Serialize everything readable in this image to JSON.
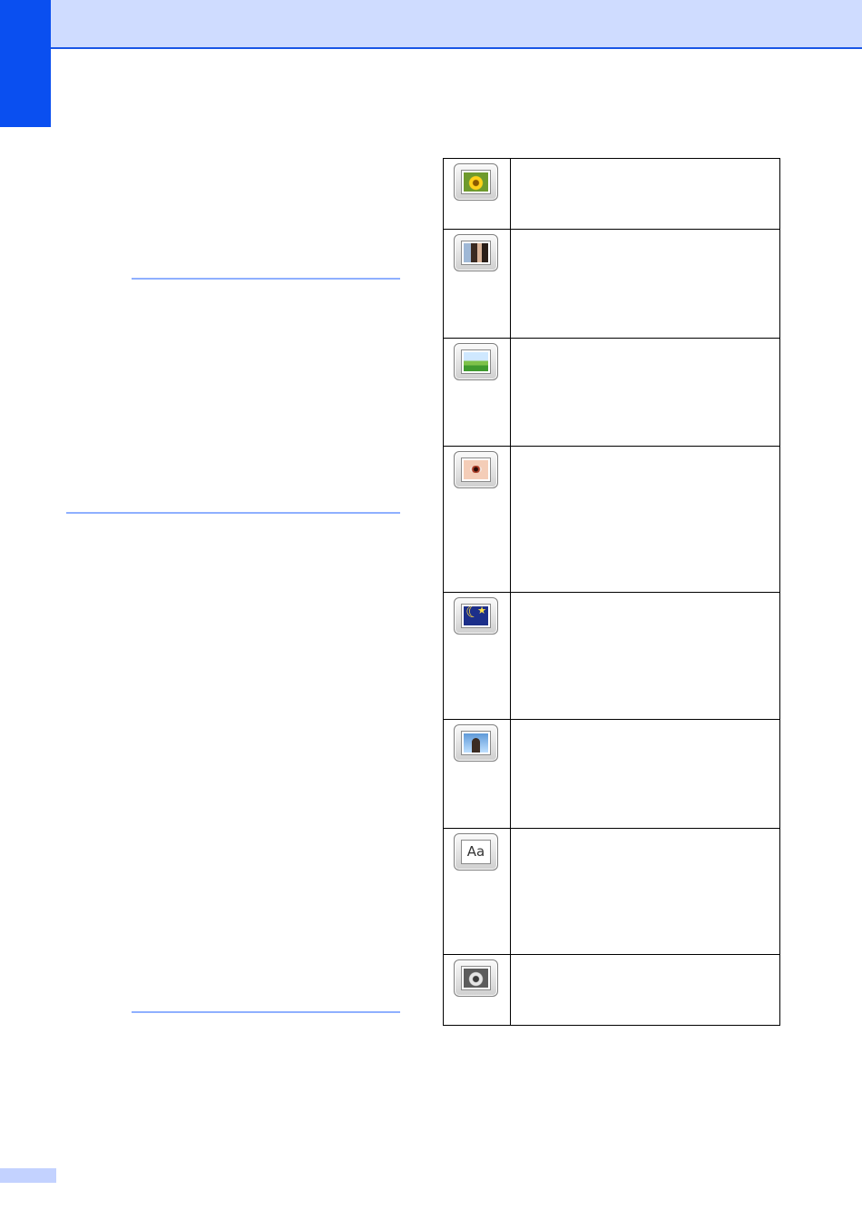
{
  "page": {
    "accent_color": "#0a4ff0",
    "header_band_color": "#cfdcff",
    "rule_color": "#8fb0ff"
  },
  "effects_table": {
    "rows": [
      {
        "icon": "auto-correct-flower-icon",
        "description": ""
      },
      {
        "icon": "enhance-skin-portrait-icon",
        "description": ""
      },
      {
        "icon": "enhance-scenery-landscape-icon",
        "description": ""
      },
      {
        "icon": "remove-red-eye-icon",
        "description": ""
      },
      {
        "icon": "night-scene-icon",
        "description": ""
      },
      {
        "icon": "fill-light-backlight-icon",
        "description": ""
      },
      {
        "icon": "whiteboard-text-icon",
        "description": "",
        "icon_text": "Aa"
      },
      {
        "icon": "monochrome-icon",
        "description": ""
      }
    ]
  }
}
